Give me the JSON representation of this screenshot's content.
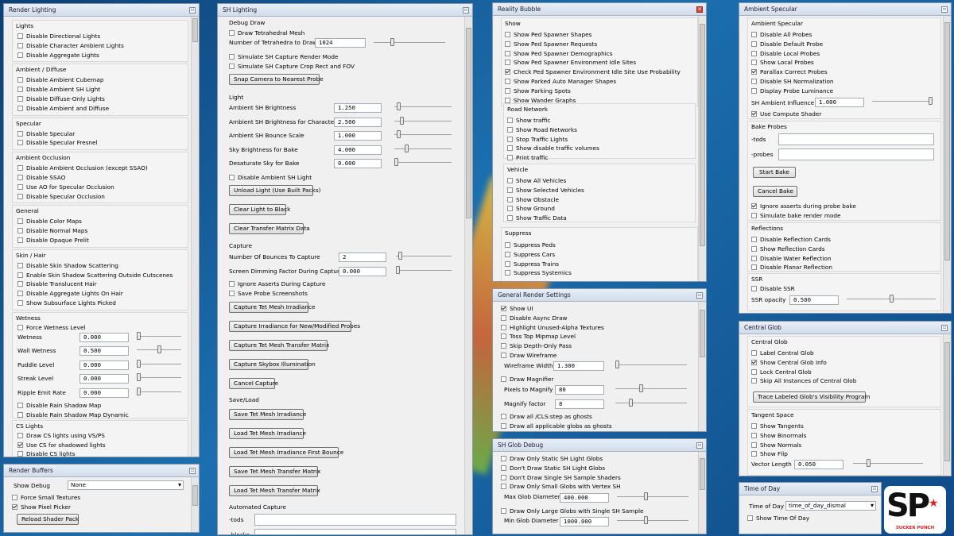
{
  "panels": {
    "render_lighting": {
      "title": "Render Lighting",
      "groups": [
        {
          "title": "Lights",
          "items": [
            {
              "label": "Disable Directional Lights",
              "checked": false
            },
            {
              "label": "Disable Character Ambient Lights",
              "checked": false
            },
            {
              "label": "Disable Aggregate Lights",
              "checked": false
            }
          ]
        },
        {
          "title": "Ambient / Diffuse",
          "items": [
            {
              "label": "Disable Ambient Cubemap",
              "checked": false
            },
            {
              "label": "Disable Ambient SH Light",
              "checked": false
            },
            {
              "label": "Disable Diffuse-Only Lights",
              "checked": false
            },
            {
              "label": "Disable Ambient and Diffuse",
              "checked": false
            }
          ]
        },
        {
          "title": "Specular",
          "items": [
            {
              "label": "Disable Specular",
              "checked": false
            },
            {
              "label": "Disable Specular Fresnel",
              "checked": false
            }
          ]
        },
        {
          "title": "Ambient Occlusion",
          "items": [
            {
              "label": "Disable Ambient Occlusion (except SSAO)",
              "checked": false
            },
            {
              "label": "Disable SSAO",
              "checked": false
            },
            {
              "label": "Use AO for Specular Occlusion",
              "checked": false
            },
            {
              "label": "Disable Specular Occlusion",
              "checked": false
            }
          ]
        },
        {
          "title": "General",
          "items": [
            {
              "label": "Disable Color Maps",
              "checked": false
            },
            {
              "label": "Disable Normal Maps",
              "checked": false
            },
            {
              "label": "Disable Opaque Prelit",
              "checked": false
            }
          ]
        },
        {
          "title": "Skin / Hair",
          "items": [
            {
              "label": "Disable Skin Shadow Scattering",
              "checked": false
            },
            {
              "label": "Enable Skin Shadow Scattering Outside Cutscenes",
              "checked": false
            },
            {
              "label": "Disable Translucent Hair",
              "checked": false
            },
            {
              "label": "Disable Aggregate Lights On Hair",
              "checked": false
            },
            {
              "label": "Show Subsurface Lights Picked",
              "checked": false
            }
          ]
        }
      ],
      "wetness": {
        "title": "Wetness",
        "force_label": "Force Wetness Level",
        "force_checked": false,
        "sliders": [
          {
            "label": "Wetness",
            "value": "0.000",
            "level": 0.0
          },
          {
            "label": "Wall Wetness",
            "value": "0.500",
            "level": 0.5
          },
          {
            "label": "Puddle Level",
            "value": "0.000",
            "level": 0.0
          },
          {
            "label": "Streak Level",
            "value": "0.000",
            "level": 0.0
          },
          {
            "label": "Ripple Emit Rate",
            "value": "0.000",
            "level": 0.0
          }
        ],
        "rain": [
          {
            "label": "Disable Rain Shadow Map",
            "checked": false
          },
          {
            "label": "Disable Rain Shadow Map Dynamic",
            "checked": false
          }
        ]
      },
      "cs_lights": {
        "title": "CS Lights",
        "items": [
          {
            "label": "Draw CS lights using VS/PS",
            "checked": false
          },
          {
            "label": "Use CS for shadowed lights",
            "checked": true
          },
          {
            "label": "Disable CS lights",
            "checked": false
          }
        ]
      }
    },
    "render_buffers": {
      "title": "Render Buffers",
      "show_debug_label": "Show Debug",
      "show_debug_value": "None",
      "items": [
        {
          "label": "Force Small Textures",
          "checked": false
        },
        {
          "label": "Show Pixel Picker",
          "checked": true
        }
      ],
      "reload_button": "Reload Shader Pack"
    },
    "sh_lighting": {
      "title": "SH Lighting",
      "debug_draw": {
        "title": "Debug Draw",
        "draw_tet_label": "Draw Tetrahedral Mesh",
        "draw_tet_checked": false,
        "num_tet_label": "Number of Tetrahedra to Draw",
        "num_tet_value": "1024",
        "num_tet_level": 0.25,
        "sim_render_label": "Simulate SH Capture Render Mode",
        "sim_crop_label": "Simulate SH Capture Crop Rect and FOV",
        "snap_button": "Snap Camera to Nearest Probe"
      },
      "light": {
        "title": "Light",
        "sliders": [
          {
            "label": "Ambient SH Brightness",
            "value": "1.250",
            "level": 0.05
          },
          {
            "label": "Ambient SH Brightness for Characters",
            "value": "2.500",
            "level": 0.1
          },
          {
            "label": "Ambient SH Bounce Scale",
            "value": "1.000",
            "level": 0.05
          },
          {
            "label": "Sky Brightness for Bake",
            "value": "4.000",
            "level": 0.2
          },
          {
            "label": "Desaturate Sky for Bake",
            "value": "0.000",
            "level": 0.0
          }
        ],
        "disable_ambient_label": "Disable Ambient SH Light",
        "buttons": [
          "Unload Light (Use Built Packs)",
          "Clear Light to Black",
          "Clear Transfer Matrix Data"
        ]
      },
      "capture": {
        "title": "Capture",
        "sliders": [
          {
            "label": "Number Of Bounces To Capture",
            "value": "2",
            "level": 0.05
          },
          {
            "label": "Screen Dimming Factor During Capture",
            "value": "0.000",
            "level": 0.0
          }
        ],
        "checks": [
          {
            "label": "Ignore Asserts During Capture",
            "checked": false
          },
          {
            "label": "Save Probe Screenshots",
            "checked": false
          }
        ],
        "buttons": [
          "Capture Tet Mesh Irradiance",
          "Capture Irradiance for New/Modified Probes",
          "Capture Tet Mesh Transfer Matrix",
          "Capture Skybox Illumination",
          "Cancel Capture"
        ]
      },
      "save_load": {
        "title": "Save/Load",
        "buttons": [
          "Save Tet Mesh Irradiance",
          "Load Tet Mesh Irradiance",
          "Load Tet Mesh Irradiance First Bounce",
          "Save Tet Mesh Transfer Matrix",
          "Load Tet Mesh Transfer Matrix"
        ]
      },
      "automated": {
        "title": "Automated Capture",
        "tods_label": "-tods",
        "blocks_label": "-blocks"
      }
    },
    "reality_bubble": {
      "title": "Reality Bubble",
      "show": {
        "title": "Show",
        "items": [
          {
            "label": "Show Ped Spawner Shapes",
            "checked": false
          },
          {
            "label": "Show Ped Spawner Requests",
            "checked": false
          },
          {
            "label": "Show Ped Spawner Demographics",
            "checked": false
          },
          {
            "label": "Show Ped Spawner Environment Idle Sites",
            "checked": false
          },
          {
            "label": "Check Ped Spawner Environment Idle Site Use Probability",
            "checked": true
          },
          {
            "label": "Show Parked Auto Manager Shapes",
            "checked": false
          },
          {
            "label": "Show Parking Spots",
            "checked": false
          },
          {
            "label": "Show Wander Graphs",
            "checked": false
          }
        ]
      },
      "road": {
        "title": "Road Network",
        "items": [
          {
            "label": "Show traffic",
            "checked": false
          },
          {
            "label": "Show Road Networks",
            "checked": false
          },
          {
            "label": "Stop Traffic Lights",
            "checked": false
          },
          {
            "label": "Show disable traffic volumes",
            "checked": false
          },
          {
            "label": "Print traffic",
            "checked": false
          }
        ]
      },
      "vehicle": {
        "title": "Vehicle",
        "items": [
          {
            "label": "Show All Vehicles",
            "checked": false
          },
          {
            "label": "Show Selected Vehicles",
            "checked": false
          },
          {
            "label": "Show Obstacle",
            "checked": false
          },
          {
            "label": "Show Ground",
            "checked": false
          },
          {
            "label": "Show Traffic Data",
            "checked": false
          }
        ]
      },
      "suppress": {
        "title": "Suppress",
        "items": [
          {
            "label": "Suppress Peds",
            "checked": false
          },
          {
            "label": "Suppress Cars",
            "checked": false
          },
          {
            "label": "Suppress Trains",
            "checked": false
          },
          {
            "label": "Suppress Systemics",
            "checked": false
          }
        ]
      }
    },
    "general_render": {
      "title": "General Render Settings",
      "items": [
        {
          "label": "Show UI",
          "checked": true
        },
        {
          "label": "Disable Async Draw",
          "checked": false
        },
        {
          "label": "Highlight Unused-Alpha Textures",
          "checked": false
        },
        {
          "label": "Toss Top Mipmap Level",
          "checked": false
        },
        {
          "label": "Skip Depth-Only Pass",
          "checked": false
        },
        {
          "label": "Draw Wireframe",
          "checked": false
        }
      ],
      "wire_label": "Wireframe Width",
      "wire_value": "1.300",
      "wire_level": 0.0,
      "magnifier_label": "Draw Magnifier",
      "magnifier_checked": false,
      "pixels_label": "Pixels to Magnify",
      "pixels_value": "80",
      "pixels_level": 0.35,
      "factor_label": "Magnify factor",
      "factor_value": "8",
      "factor_level": 0.2,
      "ghost_items": [
        {
          "label": "Draw all /CLS:step as ghosts",
          "checked": false
        },
        {
          "label": "Draw all applicable globs as ghosts",
          "checked": false
        }
      ]
    },
    "sh_glob": {
      "title": "SH Glob Debug",
      "items": [
        {
          "label": "Draw Only Static SH Light Globs",
          "checked": false
        },
        {
          "label": "Don't Draw Static SH Light Globs",
          "checked": false
        },
        {
          "label": "Don't Draw Single SH Sample Shaders",
          "checked": false
        },
        {
          "label": "Draw Only Small Globs with Vertex SH",
          "checked": false
        }
      ],
      "max_label": "Max Glob Diameter",
      "max_value": "400.000",
      "max_level": 0.4,
      "large_label": "Draw Only Large Globs with Single SH Sample",
      "large_checked": false,
      "min_label": "Min Glob Diameter",
      "min_value": "1000.000",
      "min_level": 0.4
    },
    "ambient_specular": {
      "title": "Ambient Specular",
      "group_title": "Ambient Specular",
      "items": [
        {
          "label": "Disable All Probes",
          "checked": false
        },
        {
          "label": "Disable Default Probe",
          "checked": false
        },
        {
          "label": "Disable Local Probes",
          "checked": false
        },
        {
          "label": "Show Local Probes",
          "checked": false
        },
        {
          "label": "Parallax Correct Probes",
          "checked": true
        },
        {
          "label": "Disable SH Normalization",
          "checked": false
        },
        {
          "label": "Display Probe Luminance",
          "checked": false
        }
      ],
      "influence_label": "SH Ambient Influence",
      "influence_value": "1.000",
      "influence_level": 1.0,
      "compute_label": "Use Compute Shader",
      "compute_checked": true,
      "bake": {
        "title": "Bake Probes",
        "tods_label": "-tods",
        "probes_label": "-probes",
        "start_button": "Start Bake",
        "cancel_button": "Cancel Bake",
        "items": [
          {
            "label": "Ignore asserts during probe bake",
            "checked": true
          },
          {
            "label": "Simulate bake render mode",
            "checked": false
          }
        ]
      },
      "reflections": {
        "title": "Reflections",
        "items": [
          {
            "label": "Disable Reflection Cards",
            "checked": false
          },
          {
            "label": "Show Reflection Cards",
            "checked": false
          },
          {
            "label": "Disable Water Reflection",
            "checked": false
          },
          {
            "label": "Disable Planar Reflection",
            "checked": false
          }
        ]
      },
      "ssr": {
        "title": "SSR",
        "disable_label": "Disable SSR",
        "disable_checked": false,
        "opacity_label": "SSR opacity",
        "opacity_value": "0.500",
        "opacity_level": 0.5
      }
    },
    "central_glob": {
      "title": "Central Glob",
      "group_title": "Central Glob",
      "items": [
        {
          "label": "Label Central Glob",
          "checked": false
        },
        {
          "label": "Show Central Glob Info",
          "checked": true
        },
        {
          "label": "Lock Central Glob",
          "checked": false
        },
        {
          "label": "Skip All Instances of Central Glob",
          "checked": false
        }
      ],
      "trace_button": "Trace Labeled Glob's Visibility Program",
      "tangent": {
        "title": "Tangent Space",
        "items": [
          {
            "label": "Show Tangents",
            "checked": false
          },
          {
            "label": "Show Binormals",
            "checked": false
          },
          {
            "label": "Show Normals",
            "checked": false
          },
          {
            "label": "Show Flip",
            "checked": false
          }
        ],
        "vector_label": "Vector Length",
        "vector_value": "0.050",
        "vector_level": 0.2
      }
    },
    "time_of_day": {
      "title": "Time of Day",
      "tod_label": "Time of Day",
      "tod_value": "time_of_day_dismal",
      "show_label": "Show Time Of Day",
      "show_checked": false
    }
  },
  "logo": {
    "text": "SP",
    "subtitle": "SUCKER PUNCH"
  },
  "colors": {
    "panel_bg": "#f0f0f0",
    "title_bar": "#d9e3ef",
    "desktop": "#1c6fb0"
  }
}
